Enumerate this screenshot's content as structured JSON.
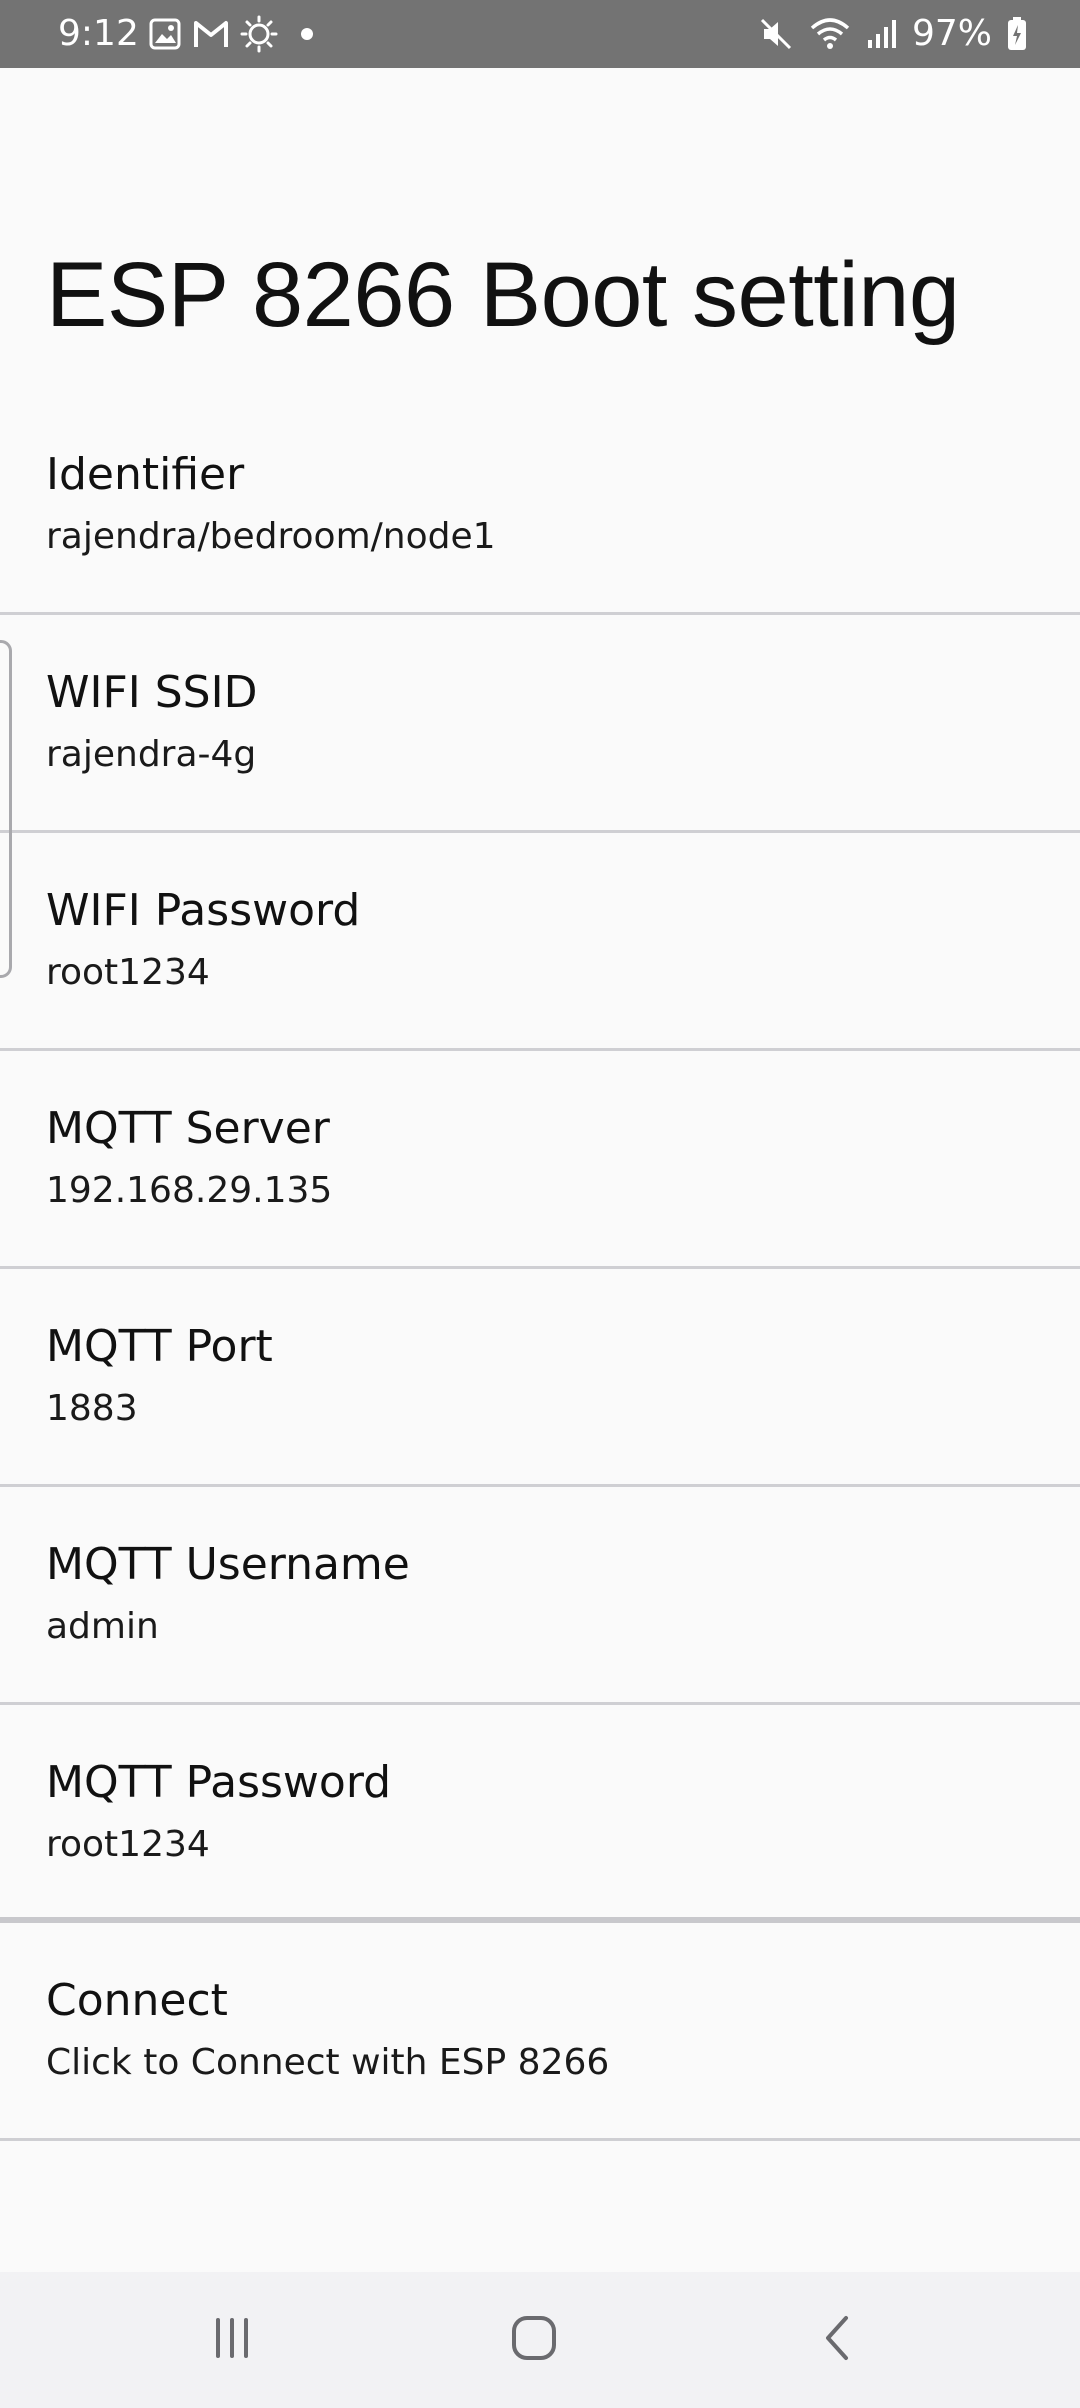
{
  "status_bar": {
    "time": "9:12",
    "battery": "97%",
    "left_icons": [
      "gallery-icon",
      "gmail-icon",
      "sun-icon",
      "dot-icon"
    ],
    "right_icons": [
      "mute-icon",
      "wifi-icon",
      "signal-icon",
      "battery-icon"
    ]
  },
  "page": {
    "title": "ESP 8266 Boot setting"
  },
  "settings": [
    {
      "title": "Identifier",
      "value": "rajendra/bedroom/node1"
    },
    {
      "title": "WIFI SSID",
      "value": "rajendra-4g"
    },
    {
      "title": "WIFI Password",
      "value": "root1234"
    },
    {
      "title": "MQTT Server",
      "value": "192.168.29.135"
    },
    {
      "title": "MQTT Port",
      "value": "1883"
    },
    {
      "title": "MQTT Username",
      "value": "admin"
    },
    {
      "title": "MQTT Password",
      "value": "root1234"
    },
    {
      "title": "Connect",
      "value": "Click to Connect with ESP 8266"
    }
  ],
  "nav_bar": {
    "buttons": [
      "recents-icon",
      "home-icon",
      "back-icon"
    ]
  },
  "colors": {
    "status_bar": "#737373",
    "background": "#fafafa",
    "divider": "#cfcfd3",
    "nav_bar": "#f2f2f4"
  }
}
